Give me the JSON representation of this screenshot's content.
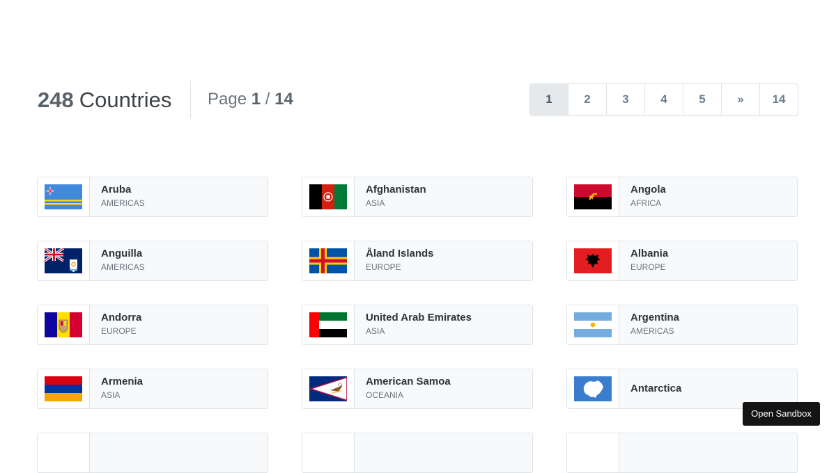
{
  "header": {
    "count": "248",
    "count_label": "Countries",
    "page_prefix": "Page",
    "page_current": "1",
    "page_sep": "/",
    "page_total": "14"
  },
  "pagination": [
    "1",
    "2",
    "3",
    "4",
    "5",
    "»",
    "14"
  ],
  "countries": [
    {
      "name": "Aruba",
      "region": "AMERICAS",
      "flag": "aruba-flag"
    },
    {
      "name": "Afghanistan",
      "region": "ASIA",
      "flag": "afghanistan-flag"
    },
    {
      "name": "Angola",
      "region": "AFRICA",
      "flag": "angola-flag"
    },
    {
      "name": "Anguilla",
      "region": "AMERICAS",
      "flag": "anguilla-flag"
    },
    {
      "name": "Åland Islands",
      "region": "EUROPE",
      "flag": "aland-flag"
    },
    {
      "name": "Albania",
      "region": "EUROPE",
      "flag": "albania-flag"
    },
    {
      "name": "Andorra",
      "region": "EUROPE",
      "flag": "andorra-flag"
    },
    {
      "name": "United Arab Emirates",
      "region": "ASIA",
      "flag": "uae-flag"
    },
    {
      "name": "Argentina",
      "region": "AMERICAS",
      "flag": "argentina-flag"
    },
    {
      "name": "Armenia",
      "region": "ASIA",
      "flag": "armenia-flag"
    },
    {
      "name": "American Samoa",
      "region": "OCEANIA",
      "flag": "american-samoa-flag"
    },
    {
      "name": "Antarctica",
      "region": "",
      "flag": "antarctica-flag"
    }
  ],
  "sandbox_button": "Open Sandbox",
  "colors": {
    "active_page_bg": "#e6e9ec",
    "card_bg": "#f8f9fa",
    "page_link": "#6a7f96"
  }
}
